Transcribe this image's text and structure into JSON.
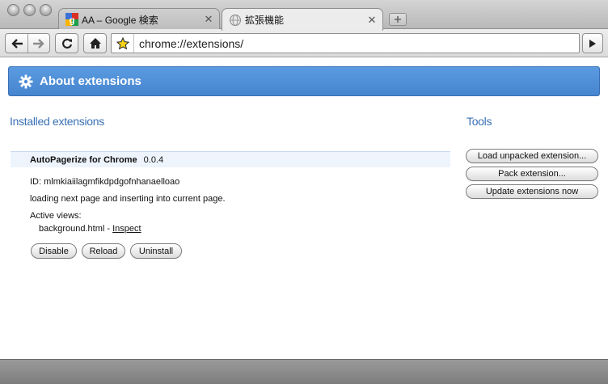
{
  "tabs": [
    {
      "title": "AA – Google 検索",
      "active": false,
      "favicon": "google-g-icon"
    },
    {
      "title": "拡張機能",
      "active": true,
      "favicon": "globe-icon"
    }
  ],
  "toolbar": {
    "url": "chrome://extensions/",
    "icons": [
      "back-arrow-icon",
      "forward-arrow-icon",
      "reload-icon",
      "home-icon",
      "star-icon",
      "go-arrow-icon"
    ]
  },
  "banner": {
    "title": "About extensions",
    "icon": "gear-icon"
  },
  "sections": {
    "installed": "Installed extensions",
    "tools": "Tools"
  },
  "extension": {
    "name": "AutoPagerize for Chrome",
    "version": "0.0.4",
    "id_line": "ID: mlmkiaiilagmfikdpdgofnhanaelloao",
    "description": "loading next page and inserting into current page.",
    "active_views_label": "Active views:",
    "view_name": "background.html",
    "view_separator": " - ",
    "inspect_label": "Inspect",
    "buttons": {
      "disable": "Disable",
      "reload": "Reload",
      "uninstall": "Uninstall"
    }
  },
  "tools": {
    "load_unpacked": "Load unpacked extension...",
    "pack": "Pack extension...",
    "update": "Update extensions now"
  },
  "colors": {
    "banner": "#4a89d4",
    "section_title": "#3a70b5",
    "ext_header": "#eef4fc"
  }
}
